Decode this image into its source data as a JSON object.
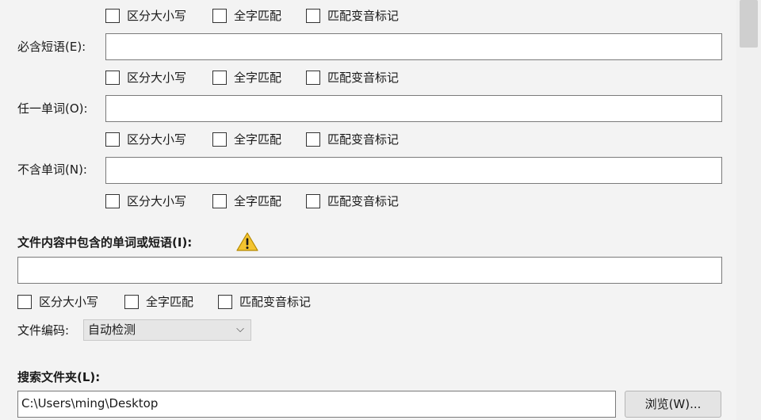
{
  "checkbox_labels": {
    "match_case": "区分大小写",
    "whole_word": "全字匹配",
    "match_diacritics": "匹配变音标记"
  },
  "fields": {
    "exact_phrase": {
      "label": "必含短语(E):",
      "value": ""
    },
    "any_word": {
      "label": "任一单词(O):",
      "value": ""
    },
    "none_word": {
      "label": "不含单词(N):",
      "value": ""
    }
  },
  "content_search": {
    "label": "文件内容中包含的单词或短语(I):",
    "value": "",
    "warning_icon": "warning-icon"
  },
  "encoding": {
    "label": "文件编码:",
    "selected": "自动检测"
  },
  "folder": {
    "label": "搜索文件夹(L):",
    "value": "C:\\Users\\ming\\Desktop",
    "browse_label": "浏览(W)..."
  },
  "colors": {
    "warning": "#f4c430",
    "field_border": "#7a7a7a"
  }
}
